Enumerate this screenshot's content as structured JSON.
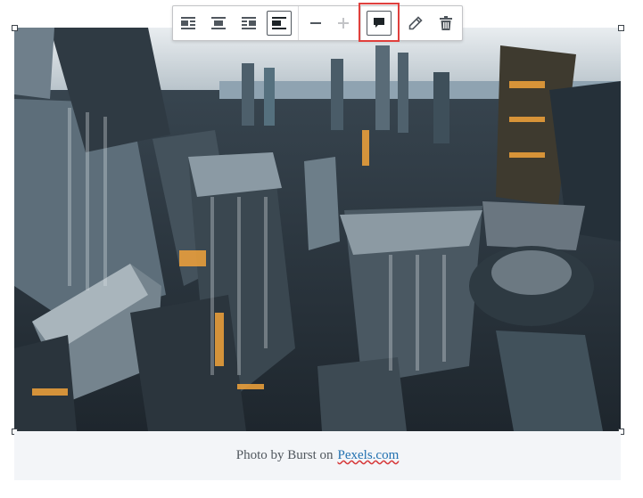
{
  "toolbar": {
    "buttons": [
      {
        "name": "align-left-button",
        "icon": "align-left-icon",
        "active": false
      },
      {
        "name": "align-center-button",
        "icon": "align-center-icon",
        "active": false
      },
      {
        "name": "align-right-button",
        "icon": "align-right-icon",
        "active": false
      },
      {
        "name": "align-none-button",
        "icon": "align-none-icon",
        "active": true
      },
      {
        "name": "shrink-button",
        "icon": "minus-icon",
        "active": false
      },
      {
        "name": "enlarge-button",
        "icon": "plus-icon",
        "active": false,
        "disabled": true
      },
      {
        "name": "toggle-caption-button",
        "icon": "comment-icon",
        "active": true
      },
      {
        "name": "edit-button",
        "icon": "pencil-icon",
        "active": false
      },
      {
        "name": "remove-button",
        "icon": "trash-icon",
        "active": false
      }
    ],
    "highlight_color": "#e0403d"
  },
  "image": {
    "alt_description": "aerial-city-photo",
    "icon": "image"
  },
  "caption": {
    "text": "Photo by Burst on",
    "link_text": "Pexels.com",
    "link_color": "#2271b1",
    "background": "#f3f5f8"
  }
}
